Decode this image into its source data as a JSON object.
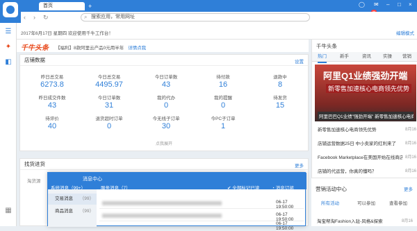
{
  "titlebar": {
    "tab_label": "首页",
    "new_tab": "+"
  },
  "addrbar": {
    "back": "‹",
    "forward": "›",
    "refresh": "↻",
    "search_placeholder": "搜索应用，常用网址",
    "notif_count": "99"
  },
  "window": {
    "min": "–",
    "max": "□",
    "close": "×"
  },
  "topstrip": {
    "date_text": "2017年6月17日 星期四  欢迎使用千牛工作台！",
    "setting": "编辑模式"
  },
  "news": {
    "brand": "千牛头条",
    "headline": "【福利】8款阿里云产品0元用半年",
    "link": "详情点我"
  },
  "shop": {
    "title": "店铺数据",
    "settings": "设置",
    "stats": [
      {
        "label": "昨日总交易",
        "value": "6273.8"
      },
      {
        "label": "今日总交易",
        "value": "4495.97"
      },
      {
        "label": "今日订单数",
        "value": "43"
      },
      {
        "label": "待付款",
        "value": "16"
      },
      {
        "label": "退款中",
        "value": "8"
      },
      {
        "label": "昨日成交件数",
        "value": "43"
      },
      {
        "label": "今日订单数",
        "value": "31"
      },
      {
        "label": "我的代办",
        "value": "0"
      },
      {
        "label": "我的提醒",
        "value": "0"
      },
      {
        "label": "待发货",
        "value": "15"
      },
      {
        "label": "待评价",
        "value": "40"
      },
      {
        "label": "退货超时订单",
        "value": "0"
      },
      {
        "label": "今无线子订单",
        "value": "30"
      },
      {
        "label": "今PC子订单",
        "value": "1"
      }
    ],
    "expand": "点我展开"
  },
  "promo": {
    "title": "找货进货",
    "more": "更多",
    "sub": "淘货源"
  },
  "headlines": {
    "title": "千牛头条",
    "tabs": [
      "热门",
      "新手",
      "资讯",
      "实操",
      "营销"
    ],
    "banner_l1": "阿里Q1业绩强劲开端",
    "banner_l2": "新零售加速核心电商领先优势",
    "banner_caption": "阿里巴巴Q1业绩\"强劲开端\" 新零售加速核心电商",
    "items": [
      {
        "text": "新零售加速核心电商领先优势",
        "date": "8月16"
      },
      {
        "text": "店铺运营数据25日 中小卖家的红利来了",
        "date": "8月16"
      },
      {
        "text": "Facebook Marketplace在美国开始在线商店了",
        "date": "8月16"
      },
      {
        "text": "店铺的代运营，你真的懂吗？",
        "date": "8月16"
      },
      {
        "text": "科技电子2017年半程：智能设备、新颖层",
        "date": "8月16"
      }
    ]
  },
  "marketing": {
    "title": "营销活动中心",
    "more": "更多",
    "tabs": [
      "所有活动",
      "可以参加",
      "查看参加"
    ],
    "item": "淘宝帮淘Fashion入驻-风格&探索",
    "item_date": "8月16"
  },
  "msg": {
    "title": "消息中心",
    "tab_sys": "系统消息（99+）",
    "tab_svc": "服务消息（7）",
    "mark_read": "全部标记已读",
    "subscribe": "消息订阅",
    "side": [
      {
        "label": "交易消息",
        "count": "（99）"
      },
      {
        "label": "商品消息",
        "count": "（99）"
      }
    ],
    "rows": [
      {
        "time": "06-17 19:50:00"
      },
      {
        "time": "06-17 19:50:00"
      },
      {
        "time": "06-17 19:50:00"
      }
    ]
  }
}
